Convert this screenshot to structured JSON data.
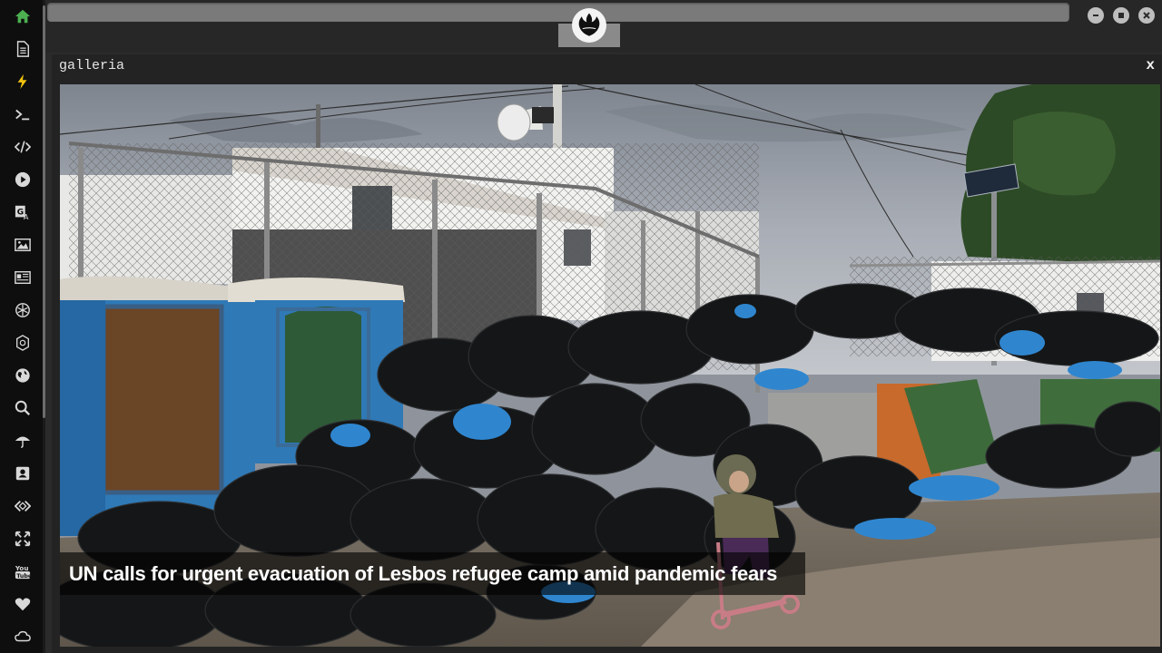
{
  "window": {
    "title": "galleria",
    "close_label": "x",
    "controls": [
      "minimize-icon",
      "maximize-icon",
      "close-icon"
    ]
  },
  "sidebar": {
    "items": [
      {
        "icon": "home-icon",
        "color": "#4caf50",
        "active": true
      },
      {
        "icon": "document-icon"
      },
      {
        "icon": "lightning-icon",
        "color": "#f1c40f"
      },
      {
        "icon": "terminal-icon"
      },
      {
        "icon": "code-icon"
      },
      {
        "icon": "play-icon"
      },
      {
        "icon": "translate-icon"
      },
      {
        "icon": "image-icon"
      },
      {
        "icon": "news-icon"
      },
      {
        "icon": "rebel-alliance-icon"
      },
      {
        "icon": "galactic-empire-icon"
      },
      {
        "icon": "globe-icon"
      },
      {
        "icon": "search-icon"
      },
      {
        "icon": "umbrella-icon"
      },
      {
        "icon": "contact-card-icon"
      },
      {
        "icon": "embed-icon"
      },
      {
        "icon": "expand-icon"
      },
      {
        "icon": "youtube-icon"
      },
      {
        "icon": "heart-icon"
      },
      {
        "icon": "cloud-icon"
      }
    ]
  },
  "topbar": {
    "logo_icon": "rebel-alliance-logo-icon"
  },
  "gallery": {
    "caption": "UN calls for urgent evacuation of Lesbos refugee camp amid pandemic fears"
  },
  "colors": {
    "accent_green": "#4caf50",
    "accent_yellow": "#f1c40f",
    "panel_bg": "#232323",
    "sidebar_bg": "#0e0e0e"
  }
}
